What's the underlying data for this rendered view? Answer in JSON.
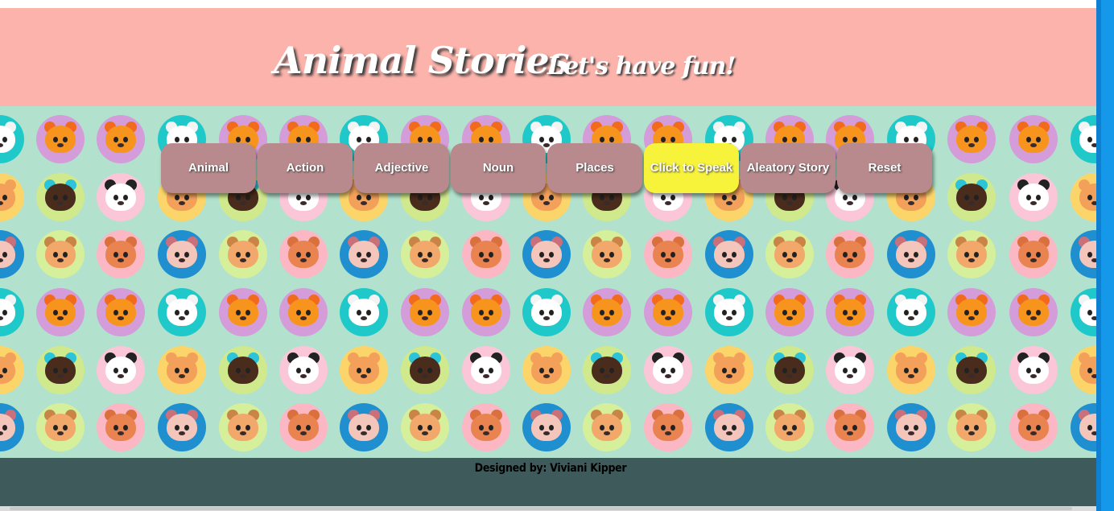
{
  "header": {
    "title": "Animal Stories",
    "subtitle": "Let's have fun!",
    "background": "#fbb3ab"
  },
  "toolbar": {
    "buttons": [
      {
        "label": "Animal"
      },
      {
        "label": "Action"
      },
      {
        "label": "Adjective"
      },
      {
        "label": "Noun"
      },
      {
        "label": "Places"
      },
      {
        "label": "Click to Speak"
      },
      {
        "label": "Aleatory Story"
      },
      {
        "label": "Reset"
      }
    ],
    "button_color": "#b88a8d",
    "active_button_color": "#f7f23a"
  },
  "pattern": {
    "background": "#b2e2cd",
    "animals": [
      "fox-icon",
      "duck-icon",
      "panda-icon",
      "monkey-icon",
      "bee-icon",
      "bear-icon",
      "owl-icon",
      "deer-icon"
    ]
  },
  "footer": {
    "credit": "Designed by: Viviani Kipper",
    "background": "#3f5a5a"
  }
}
